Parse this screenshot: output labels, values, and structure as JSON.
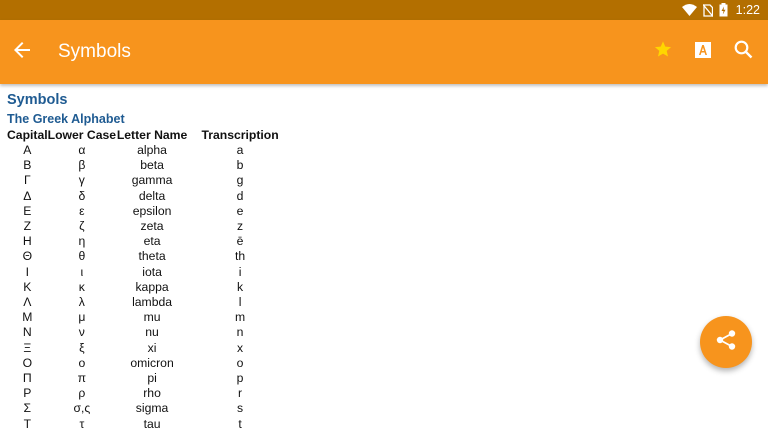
{
  "status": {
    "time": "1:22"
  },
  "appbar": {
    "title": "Symbols"
  },
  "content": {
    "heading": "Symbols",
    "subheading": "The Greek Alphabet",
    "columns": [
      "Capital",
      "Lower Case",
      "Letter Name",
      "Transcription"
    ],
    "rows": [
      [
        "Α",
        "α",
        "alpha",
        "a"
      ],
      [
        "Β",
        "β",
        "beta",
        "b"
      ],
      [
        "Γ",
        "γ",
        "gamma",
        "g"
      ],
      [
        "Δ",
        "δ",
        "delta",
        "d"
      ],
      [
        "Ε",
        "ε",
        "epsilon",
        "e"
      ],
      [
        "Ζ",
        "ζ",
        "zeta",
        "z"
      ],
      [
        "Η",
        "η",
        "eta",
        "ē"
      ],
      [
        "Θ",
        "θ",
        "theta",
        "th"
      ],
      [
        "Ι",
        "ι",
        "iota",
        "i"
      ],
      [
        "Κ",
        "κ",
        "kappa",
        "k"
      ],
      [
        "Λ",
        "λ",
        "lambda",
        "l"
      ],
      [
        "Μ",
        "μ",
        "mu",
        "m"
      ],
      [
        "Ν",
        "ν",
        "nu",
        "n"
      ],
      [
        "Ξ",
        "ξ",
        "xi",
        "x"
      ],
      [
        "Ο",
        "ο",
        "omicron",
        "o"
      ],
      [
        "Π",
        "π",
        "pi",
        "p"
      ],
      [
        "Ρ",
        "ρ",
        "rho",
        "r"
      ],
      [
        "Σ",
        "σ,ς",
        "sigma",
        "s"
      ],
      [
        "Τ",
        "τ",
        "tau",
        "t"
      ]
    ]
  },
  "icons": {
    "status": [
      "wifi-icon",
      "no-sim-icon",
      "battery-charging-icon"
    ],
    "appbar": [
      "back-arrow-icon",
      "star-icon",
      "font-size-icon",
      "search-icon"
    ],
    "fab": "share-icon"
  },
  "colors": {
    "status_bar": "#b36f00",
    "app_bar": "#f7941d",
    "star": "#ffd600",
    "heading": "#1f5b92",
    "fab": "#f7941d"
  }
}
